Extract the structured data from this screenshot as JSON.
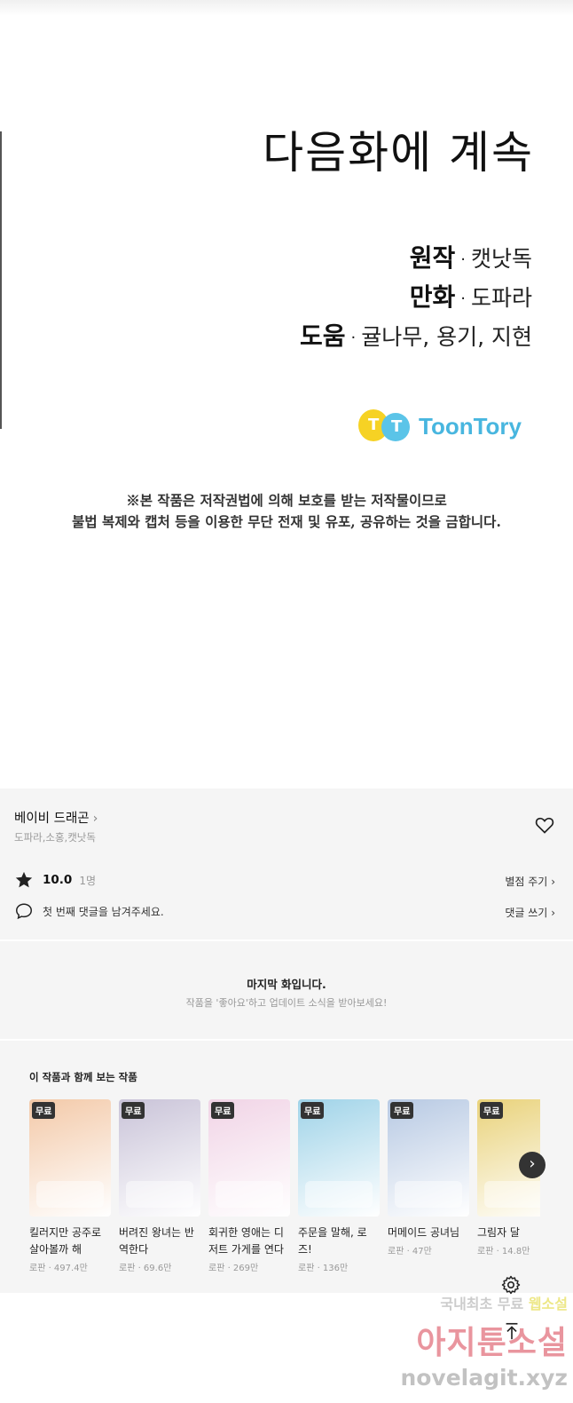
{
  "comic": {
    "next_text": "다음화에 계속",
    "credits": [
      {
        "role": "원작",
        "name": "캣낫독"
      },
      {
        "role": "만화",
        "name": "도파라"
      },
      {
        "role": "도움",
        "name": "귤나무, 용기, 지현"
      }
    ],
    "logo_text": "ToonTory",
    "notice_line1": "※본 작품은 저작권법에 의해 보호를 받는 저작물이므로",
    "notice_line2": "불법 복제와 캡처 등을 이용한 무단 전재 및 유포, 공유하는 것을 금합니다."
  },
  "work": {
    "title": "베이비 드래곤",
    "authors": "도파라,소홍,캣낫독",
    "rating": "10.0",
    "rating_count": "1명",
    "rate_link": "별점 주기",
    "comment_placeholder": "첫 번째 댓글을 남겨주세요.",
    "comment_link": "댓글 쓰기"
  },
  "last_episode": {
    "title": "마지막 화입니다.",
    "subtitle": "작품을 '좋아요'하고 업데이트 소식을 받아보세요!"
  },
  "recommendations": {
    "heading": "이 작품과 함께 보는 작품",
    "items": [
      {
        "badge": "무료",
        "title": "킬러지만 공주로 살아볼까 해",
        "meta": "로판 · 497.4만",
        "color": "#f3c9a8"
      },
      {
        "badge": "무료",
        "title": "버려진 왕녀는 반역한다",
        "meta": "로판 · 69.6만",
        "color": "#c9c3d8"
      },
      {
        "badge": "무료",
        "title": "회귀한 영애는 디저트 가게를 연다",
        "meta": "로판 · 269만",
        "color": "#f1d4e6"
      },
      {
        "badge": "무료",
        "title": "주문을 말해, 로즈!",
        "meta": "로판 · 136만",
        "color": "#9fd3e8"
      },
      {
        "badge": "무료",
        "title": "머메이드 공녀님",
        "meta": "로판 · 47만",
        "color": "#b7c9e3"
      },
      {
        "badge": "무료",
        "title": "그림자 달",
        "meta": "로판 · 14.8만",
        "color": "#e9d27a"
      }
    ]
  },
  "watermark": {
    "line1_a": "국내최초 무료 ",
    "line1_b": "웹소설",
    "line2": "아지툰소설",
    "line3": "novelagit.xyz"
  }
}
